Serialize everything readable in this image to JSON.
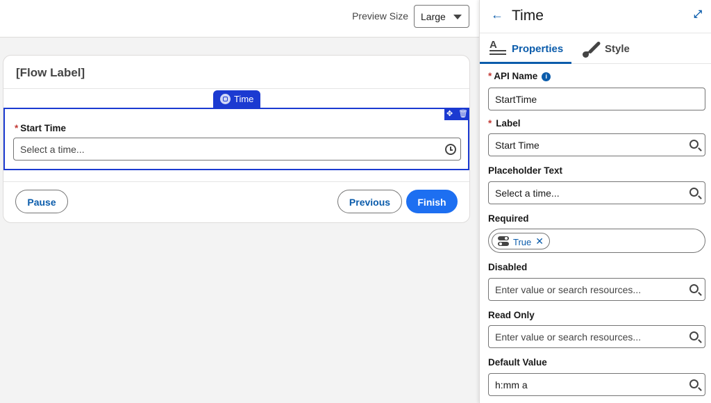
{
  "toolbar": {
    "preview_size_label": "Preview Size",
    "preview_size_value": "Large"
  },
  "canvas": {
    "flow_label": "[Flow Label]",
    "component_tag": "Time",
    "field": {
      "required_marker": "*",
      "label": "Start Time",
      "placeholder": "Select a time..."
    },
    "buttons": {
      "pause": "Pause",
      "previous": "Previous",
      "finish": "Finish"
    }
  },
  "panel": {
    "title": "Time",
    "tabs": {
      "properties": "Properties",
      "style": "Style"
    },
    "fields": {
      "api_name": {
        "required_marker": "*",
        "label": "API Name",
        "value": "StartTime"
      },
      "label": {
        "required_marker": "*",
        "label": "Label",
        "value": "Start Time"
      },
      "placeholder_text": {
        "label": "Placeholder Text",
        "value": "Select a time..."
      },
      "required": {
        "label": "Required",
        "pill": "True"
      },
      "disabled": {
        "label": "Disabled",
        "placeholder": "Enter value or search resources..."
      },
      "read_only": {
        "label": "Read Only",
        "placeholder": "Enter value or search resources..."
      },
      "default_value": {
        "label": "Default Value",
        "value": "h:mm a"
      }
    }
  },
  "colors": {
    "brand_blue": "#1b3ad1",
    "link_blue": "#0b5cab",
    "button_blue": "#1d6ff1",
    "required_red": "#c23934"
  }
}
